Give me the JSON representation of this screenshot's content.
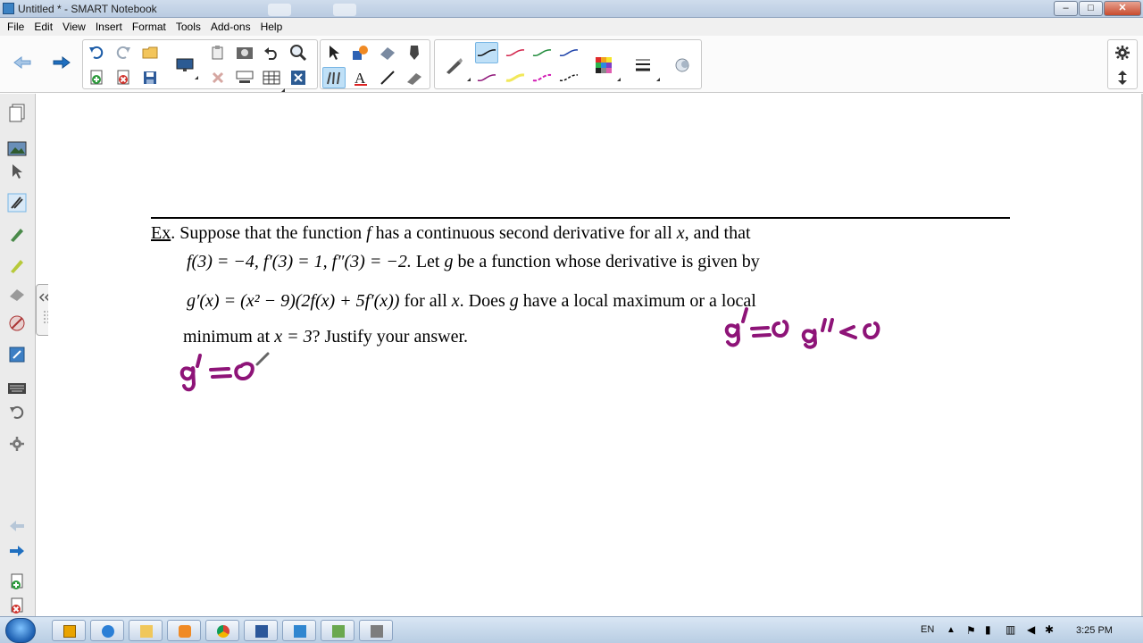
{
  "window": {
    "title": "Untitled * - SMART Notebook"
  },
  "menu": [
    "File",
    "Edit",
    "View",
    "Insert",
    "Format",
    "Tools",
    "Add-ons",
    "Help"
  ],
  "toolbar": {
    "buttons": [
      "back-arrow-icon",
      "forward-arrow-icon",
      "undo-icon",
      "redo-icon",
      "open-file-icon",
      "add-page-icon",
      "delete-page-icon",
      "save-icon",
      "display-icon",
      "paste-icon",
      "screen-capture-icon",
      "undo-capture-icon",
      "magnifier-icon",
      "select-icon",
      "shapes-icon",
      "eraser-icon",
      "pen-icon",
      "fill-icon",
      "text-icon",
      "line-icon",
      "highlighter-icon",
      "properties-icon",
      "magic-pen-icon"
    ],
    "accent": "#2f86d0"
  },
  "problem": {
    "label": "Ex",
    "line1_a": ". Suppose that the function ",
    "line1_f": "f",
    "line1_b": " has a continuous second derivative for all ",
    "line1_x": "x",
    "line1_c": ", and that",
    "line2": "f(3) = −4,  f′(3) = 1,  f″(3) = −2.",
    "line2_b": "  Let ",
    "line2_g": "g",
    "line2_c": " be a function whose derivative is given by",
    "line3_formula": "g′(x) = (x² − 9)(2f(x) + 5f′(x))",
    "line3_b": "  for all ",
    "line3_x": "x",
    "line3_c": ".  Does ",
    "line3_g": "g",
    "line3_d": " have a local maximum or a local",
    "line4_a": "minimum at ",
    "line4_eq": "x = 3",
    "line4_b": "?  Justify your answer."
  },
  "ink_notes": {
    "color": "#8e1478",
    "note1": "g′ = 0",
    "note2": "g′ = 0   g″ < 0"
  },
  "taskbar": {
    "language": "EN",
    "time": "3:25 PM"
  }
}
